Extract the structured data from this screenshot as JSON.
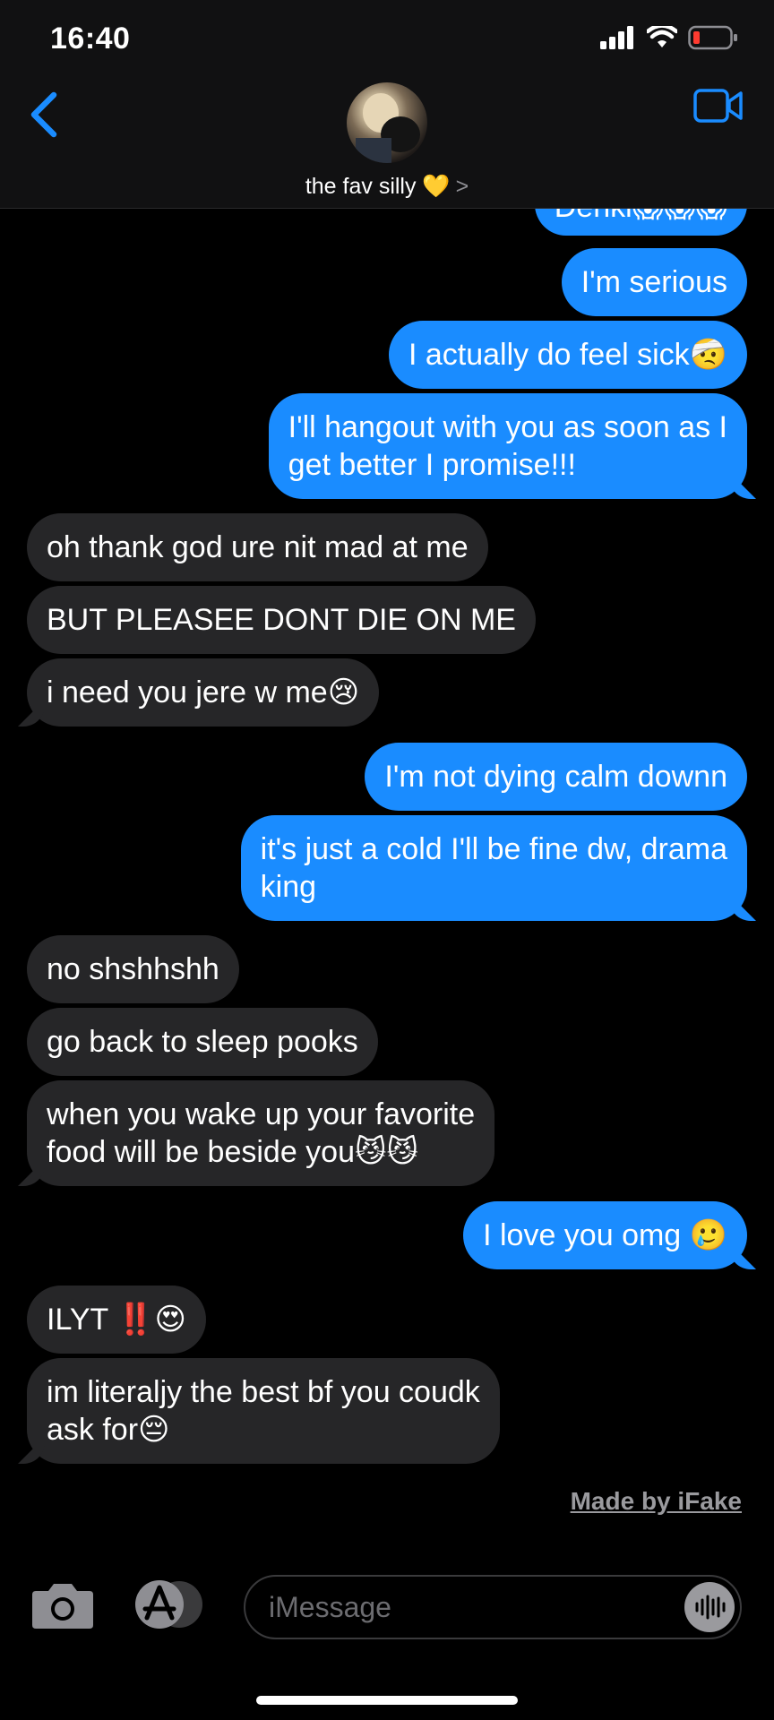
{
  "status_bar": {
    "time": "16:40"
  },
  "header": {
    "contact_name": "the fav silly 💛",
    "chevron": ">"
  },
  "messages": [
    {
      "side": "out",
      "text": "Denki😱😱😱"
    },
    {
      "side": "out",
      "text": "I'm serious"
    },
    {
      "side": "out",
      "text": "I actually do feel sick🤕"
    },
    {
      "side": "out",
      "text": "I'll hangout with you as soon as I\nget better I promise!!!"
    },
    {
      "side": "in",
      "text": "oh thank god ure nit mad at me"
    },
    {
      "side": "in",
      "text": "BUT PLEASEE DONT DIE ON ME"
    },
    {
      "side": "in",
      "text": "i need you jere w me😢"
    },
    {
      "side": "out",
      "text": "I'm not dying calm downn"
    },
    {
      "side": "out",
      "text": "it's just a cold I'll be fine dw, drama\nking"
    },
    {
      "side": "in",
      "text": "no shshhshh"
    },
    {
      "side": "in",
      "text": "go back to sleep pooks"
    },
    {
      "side": "in",
      "text": "when you wake up your favorite\nfood will be beside you😼😼"
    },
    {
      "side": "out",
      "text": "I love you omg 🥲"
    },
    {
      "side": "in",
      "text": "ILYT ‼️😍"
    },
    {
      "side": "in",
      "text": "im literaljy the best bf you coudk\nask for😔"
    }
  ],
  "watermark": "Made by iFake",
  "input": {
    "placeholder": "iMessage"
  },
  "icons": {
    "back": "chevron-left-icon",
    "video": "video-camera-icon",
    "camera": "camera-icon",
    "app_store": "app-store-icon",
    "audio": "audio-waveform-icon"
  },
  "colors": {
    "accent": "#1a8cff",
    "incoming_bubble": "#262628",
    "background": "#000000"
  }
}
